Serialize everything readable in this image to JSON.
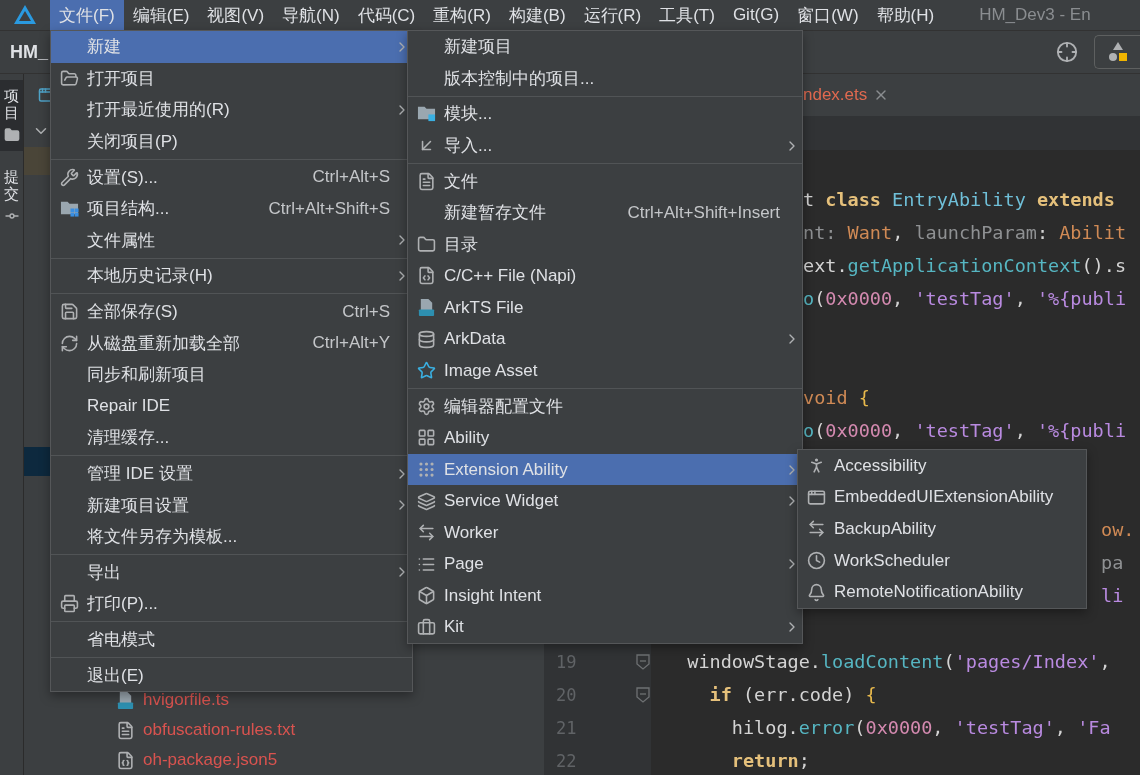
{
  "menubar": {
    "items": [
      {
        "label": "文件(F)",
        "selected": true
      },
      {
        "label": "编辑(E)",
        "selected": false
      },
      {
        "label": "视图(V)",
        "selected": false
      },
      {
        "label": "导航(N)",
        "selected": false
      },
      {
        "label": "代码(C)",
        "selected": false
      },
      {
        "label": "重构(R)",
        "selected": false
      },
      {
        "label": "构建(B)",
        "selected": false
      },
      {
        "label": "运行(R)",
        "selected": false
      },
      {
        "label": "工具(T)",
        "selected": false
      },
      {
        "label": "Git(G)",
        "selected": false
      },
      {
        "label": "窗口(W)",
        "selected": false
      },
      {
        "label": "帮助(H)",
        "selected": false
      }
    ],
    "title": "HM_Dev3 - En"
  },
  "toolbar": {
    "project_name": "HM_"
  },
  "tool_strip": [
    {
      "label": "项目",
      "selected": true
    },
    {
      "label": "提交",
      "selected": false
    }
  ],
  "project_tree": {
    "files": [
      {
        "name": "hvigorfile.ts"
      },
      {
        "name": "obfuscation-rules.txt"
      },
      {
        "name": "oh-package.json5"
      }
    ]
  },
  "editor": {
    "tab": {
      "label": "ndex.ets"
    },
    "lines": [
      {
        "kind": "blank"
      },
      {
        "kind": "cut",
        "tokens": [
          {
            "text": "t ",
            "kind": "plain"
          },
          {
            "text": "class ",
            "kind": "keyword"
          },
          {
            "text": "EntryAbility ",
            "kind": "type"
          },
          {
            "text": "extends",
            "kind": "keyword"
          }
        ]
      },
      {
        "kind": "cut",
        "tokens": [
          {
            "text": "nt: ",
            "kind": "param"
          },
          {
            "text": "Want",
            "kind": "ptype"
          },
          {
            "text": ", ",
            "kind": "plain"
          },
          {
            "text": "launchParam",
            "kind": "param"
          },
          {
            "text": ": ",
            "kind": "plain"
          },
          {
            "text": "Abilit",
            "kind": "ptype"
          }
        ]
      },
      {
        "kind": "cut",
        "tokens": [
          {
            "text": "ext.",
            "kind": "plain"
          },
          {
            "text": "getApplicationContext",
            "kind": "method"
          },
          {
            "text": "().s",
            "kind": "plain"
          }
        ]
      },
      {
        "kind": "cut",
        "tokens": [
          {
            "text": "o",
            "kind": "method"
          },
          {
            "text": "(",
            "kind": "plain"
          },
          {
            "text": "0x0000",
            "kind": "number"
          },
          {
            "text": ", ",
            "kind": "plain"
          },
          {
            "text": "'testTag'",
            "kind": "string"
          },
          {
            "text": ", ",
            "kind": "plain"
          },
          {
            "text": "'%{publi",
            "kind": "string"
          }
        ]
      },
      {
        "kind": "blank"
      },
      {
        "kind": "blank"
      },
      {
        "kind": "cut",
        "tokens": [
          {
            "text": "void ",
            "kind": "ptype"
          },
          {
            "text": "{",
            "kind": "brace"
          }
        ]
      },
      {
        "kind": "cut",
        "tokens": [
          {
            "text": "o",
            "kind": "method"
          },
          {
            "text": "(",
            "kind": "plain"
          },
          {
            "text": "0x0000",
            "kind": "number"
          },
          {
            "text": ", ",
            "kind": "plain"
          },
          {
            "text": "'testTag'",
            "kind": "string"
          },
          {
            "text": ", ",
            "kind": "plain"
          },
          {
            "text": "'%{publi",
            "kind": "string"
          }
        ]
      },
      {
        "kind": "blank"
      },
      {
        "kind": "blank"
      },
      {
        "kind": "cut_far",
        "tokens": [
          {
            "text": "ow.",
            "kind": "ptype"
          }
        ]
      },
      {
        "kind": "cut_far",
        "tokens": [
          {
            "text": "pa",
            "kind": "param"
          }
        ]
      },
      {
        "kind": "cut_far",
        "tokens": [
          {
            "text": "li",
            "kind": "string"
          }
        ]
      },
      {
        "kind": "blank"
      },
      {
        "kind": "full",
        "number": "19",
        "tokens": [
          {
            "text": "  windowStage.",
            "kind": "plain"
          },
          {
            "text": "loadContent",
            "kind": "method"
          },
          {
            "text": "(",
            "kind": "plain"
          },
          {
            "text": "'pages/Index'",
            "kind": "string"
          },
          {
            "text": ",",
            "kind": "plain"
          }
        ]
      },
      {
        "kind": "full",
        "number": "20",
        "tokens": [
          {
            "text": "    if",
            "kind": "keyword"
          },
          {
            "text": " (err.code) ",
            "kind": "plain"
          },
          {
            "text": "{",
            "kind": "brace"
          }
        ]
      },
      {
        "kind": "full",
        "number": "21",
        "tokens": [
          {
            "text": "      hilog.",
            "kind": "plain"
          },
          {
            "text": "error",
            "kind": "method"
          },
          {
            "text": "(",
            "kind": "plain"
          },
          {
            "text": "0x0000",
            "kind": "number"
          },
          {
            "text": ", ",
            "kind": "plain"
          },
          {
            "text": "'testTag'",
            "kind": "string"
          },
          {
            "text": ", ",
            "kind": "plain"
          },
          {
            "text": "'Fa",
            "kind": "string"
          }
        ]
      },
      {
        "kind": "full",
        "number": "22",
        "tokens": [
          {
            "text": "      return",
            "kind": "keyword"
          },
          {
            "text": ";",
            "kind": "plain"
          }
        ]
      }
    ]
  },
  "file_menu": {
    "groups": [
      [
        {
          "label": "新建",
          "submenu": true,
          "selected": true
        },
        {
          "label": "打开项目",
          "submenu": false,
          "selected": false
        },
        {
          "label": "打开最近使用的(R)",
          "submenu": true,
          "selected": false
        },
        {
          "label": "关闭项目(P)",
          "submenu": false,
          "selected": false
        }
      ],
      [
        {
          "label": "设置(S)...",
          "shortcut": "Ctrl+Alt+S",
          "submenu": false,
          "selected": false
        },
        {
          "label": "项目结构...",
          "shortcut": "Ctrl+Alt+Shift+S",
          "submenu": false,
          "selected": false
        },
        {
          "label": "文件属性",
          "submenu": true,
          "selected": false
        }
      ],
      [
        {
          "label": "本地历史记录(H)",
          "submenu": true,
          "selected": false
        }
      ],
      [
        {
          "label": "全部保存(S)",
          "shortcut": "Ctrl+S",
          "submenu": false,
          "selected": false
        },
        {
          "label": "从磁盘重新加载全部",
          "shortcut": "Ctrl+Alt+Y",
          "submenu": false,
          "selected": false
        },
        {
          "label": "同步和刷新项目",
          "submenu": false,
          "selected": false
        },
        {
          "label": "Repair IDE",
          "submenu": false,
          "selected": false
        },
        {
          "label": "清理缓存...",
          "submenu": false,
          "selected": false
        }
      ],
      [
        {
          "label": "管理 IDE 设置",
          "submenu": true,
          "selected": false
        },
        {
          "label": "新建项目设置",
          "submenu": true,
          "selected": false
        },
        {
          "label": "将文件另存为模板...",
          "submenu": false,
          "selected": false
        }
      ],
      [
        {
          "label": "导出",
          "submenu": true,
          "selected": false
        },
        {
          "label": "打印(P)...",
          "submenu": false,
          "selected": false
        }
      ],
      [
        {
          "label": "省电模式",
          "submenu": false,
          "selected": false
        }
      ],
      [
        {
          "label": "退出(E)",
          "submenu": false,
          "selected": false
        }
      ]
    ]
  },
  "new_menu": {
    "groups": [
      [
        {
          "label": "新建项目",
          "submenu": false,
          "selected": false
        },
        {
          "label": "版本控制中的项目...",
          "submenu": false,
          "selected": false
        }
      ],
      [
        {
          "label": "模块...",
          "submenu": false,
          "selected": false
        },
        {
          "label": "导入...",
          "submenu": true,
          "selected": false
        }
      ],
      [
        {
          "label": "文件",
          "submenu": false,
          "selected": false
        },
        {
          "label": "新建暂存文件",
          "shortcut": "Ctrl+Alt+Shift+Insert",
          "submenu": false,
          "selected": false
        },
        {
          "label": "目录",
          "submenu": false,
          "selected": false
        },
        {
          "label": "C/C++ File (Napi)",
          "submenu": false,
          "selected": false
        },
        {
          "label": "ArkTS File",
          "submenu": false,
          "selected": false
        },
        {
          "label": "ArkData",
          "submenu": true,
          "selected": false
        },
        {
          "label": "Image Asset",
          "submenu": false,
          "selected": false
        }
      ],
      [
        {
          "label": "编辑器配置文件",
          "submenu": false,
          "selected": false
        },
        {
          "label": "Ability",
          "submenu": false,
          "selected": false
        },
        {
          "label": "Extension Ability",
          "submenu": true,
          "selected": true
        },
        {
          "label": "Service Widget",
          "submenu": true,
          "selected": false
        },
        {
          "label": "Worker",
          "submenu": false,
          "selected": false
        },
        {
          "label": "Page",
          "submenu": true,
          "selected": false
        },
        {
          "label": "Insight Intent",
          "submenu": false,
          "selected": false
        },
        {
          "label": "Kit",
          "submenu": true,
          "selected": false
        }
      ]
    ]
  },
  "extension_menu": {
    "groups": [
      [
        {
          "label": "Accessibility",
          "submenu": false,
          "selected": false
        },
        {
          "label": "EmbeddedUIExtensionAbility",
          "submenu": false,
          "selected": false
        },
        {
          "label": "BackupAbility",
          "submenu": false,
          "selected": false
        },
        {
          "label": "WorkScheduler",
          "submenu": false,
          "selected": false
        },
        {
          "label": "RemoteNotificationAbility",
          "submenu": false,
          "selected": false
        }
      ]
    ]
  }
}
